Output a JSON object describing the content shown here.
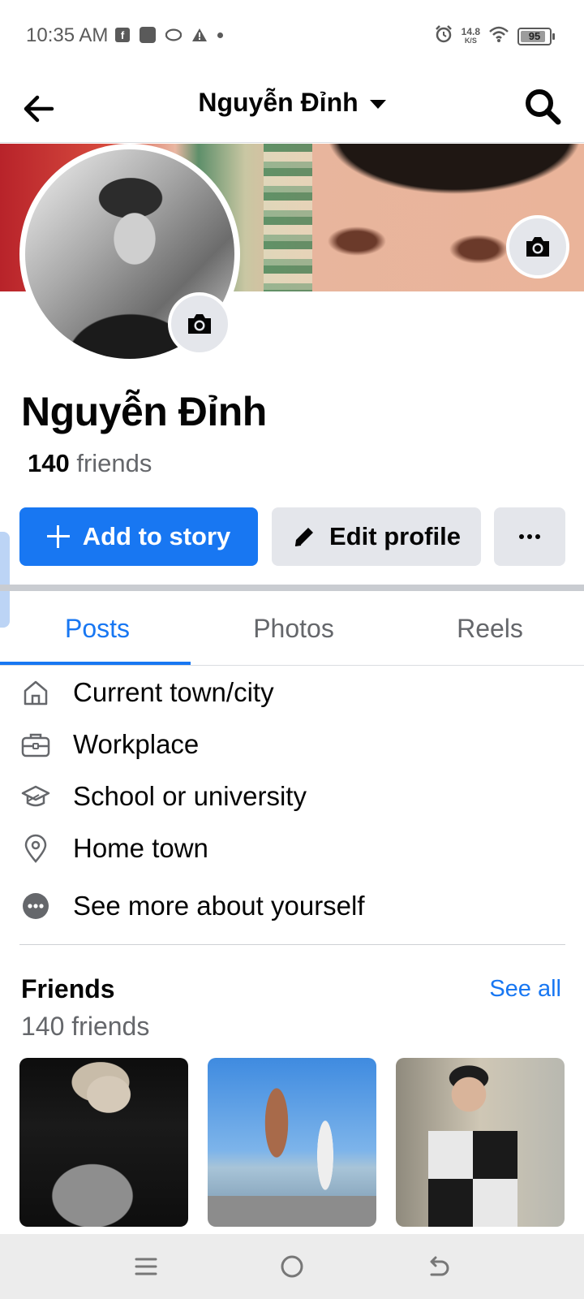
{
  "status_bar": {
    "time": "10:35 AM",
    "net_speed_value": "14.8",
    "net_speed_unit": "K/S",
    "battery": "95"
  },
  "header": {
    "title": "Nguyễn Đỉnh"
  },
  "profile": {
    "name": "Nguyễn Đỉnh",
    "friends_number": "140",
    "friends_word": "friends"
  },
  "actions": {
    "add_story": "Add to story",
    "edit_profile": "Edit profile",
    "more": "···"
  },
  "tabs": [
    {
      "label": "Posts",
      "active": true
    },
    {
      "label": "Photos",
      "active": false
    },
    {
      "label": "Reels",
      "active": false
    }
  ],
  "about": [
    {
      "label": "Current town/city",
      "icon": "home-icon"
    },
    {
      "label": "Workplace",
      "icon": "briefcase-icon"
    },
    {
      "label": "School or university",
      "icon": "graduation-cap-icon"
    },
    {
      "label": "Home town",
      "icon": "location-pin-icon"
    },
    {
      "label": "See more about yourself",
      "icon": "more-dots-icon"
    }
  ],
  "friends": {
    "title": "Friends",
    "see_all": "See all",
    "count_label": "140 friends"
  },
  "colors": {
    "accent": "#1877f2",
    "secondary_button": "#e4e6eb",
    "muted_text": "#65676b"
  }
}
